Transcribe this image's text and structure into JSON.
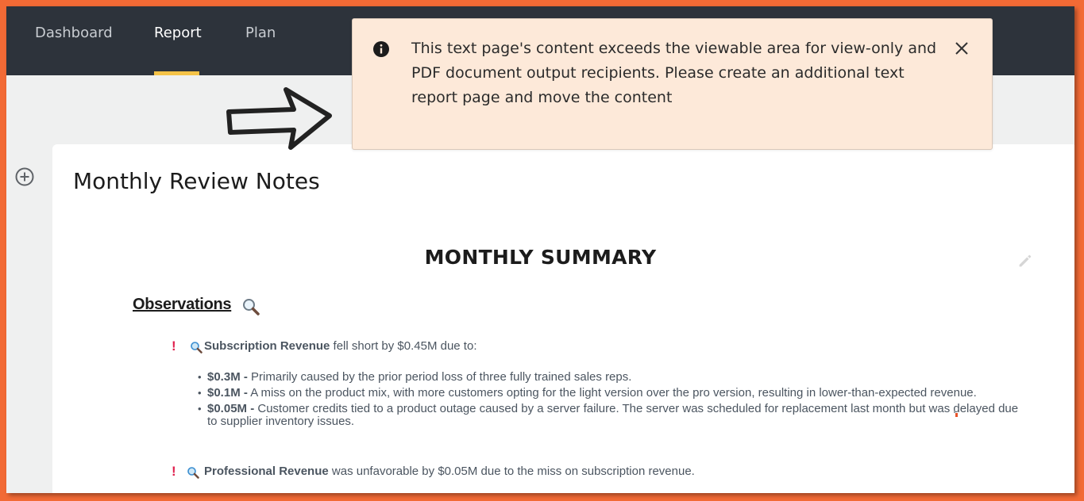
{
  "nav": {
    "tabs": [
      {
        "label": "Dashboard",
        "active": false
      },
      {
        "label": "Report",
        "active": true
      },
      {
        "label": "Plan",
        "active": false
      }
    ]
  },
  "toast": {
    "message": "This text page's content exceeds the viewable area for view-only and PDF document output recipients. Please create an additional text report page and move the content",
    "info_icon": "info-icon",
    "close_icon": "close-icon"
  },
  "page": {
    "title": "Monthly Review Notes",
    "summary_title": "MONTHLY SUMMARY",
    "observations_label": "Observations",
    "items": [
      {
        "strong": "Subscription Revenue",
        "rest": " fell short by $0.45M due to:",
        "bullets": [
          {
            "amount": "$0.3M -",
            "text": " Primarily caused by the prior period loss of three fully trained sales reps."
          },
          {
            "amount": "$0.1M -",
            "text": " A miss on the product mix, with more customers opting for the light version over the pro version, resulting in lower-than-expected revenue."
          },
          {
            "amount": "$0.05M -",
            "text": " Customer credits tied to a product outage caused by a server failure. The server was scheduled for replacement last month but was delayed due to supplier inventory issues."
          }
        ]
      },
      {
        "strong": "Professional Revenue",
        "rest": " was unfavorable by $0.05M due to the miss on subscription revenue."
      }
    ]
  },
  "colors": {
    "border": "#f26a35",
    "topbar": "#2d333b",
    "active_tab_underline": "#f5c347",
    "toast_bg": "#fde9d9",
    "alert_red": "#e0224f"
  }
}
